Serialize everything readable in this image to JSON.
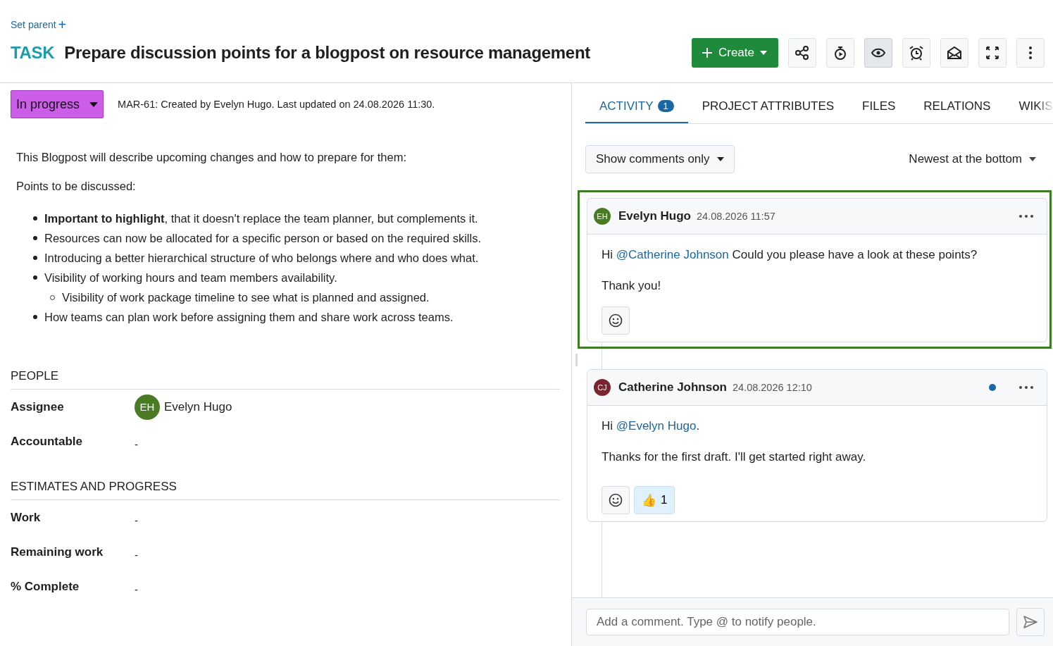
{
  "set_parent": {
    "label": "Set parent",
    "icon": "+"
  },
  "title": {
    "type": "TASK",
    "text": "Prepare discussion points for a blogpost on resource management"
  },
  "toolbar": {
    "create": {
      "label": "Create"
    },
    "buttons": [
      {
        "kind": "share",
        "selected": false
      },
      {
        "kind": "timer",
        "selected": false
      },
      {
        "kind": "watch",
        "selected": true
      },
      {
        "kind": "reminder",
        "selected": false
      },
      {
        "kind": "mail",
        "selected": false
      },
      {
        "kind": "fullscreen",
        "selected": false
      },
      {
        "kind": "more",
        "selected": false
      }
    ]
  },
  "status": {
    "label": "In progress",
    "color": "#cc5de8"
  },
  "meta": "MAR-61: Created by Evelyn Hugo. Last updated on 24.08.2026 11:30.",
  "description": {
    "paragraphs": [
      "This Blogpost will describe upcoming changes and how to prepare for them:",
      "Points to be discussed:"
    ],
    "bullets": [
      {
        "text": "**Important to highlight**, that it doesn't replace the team planner, but complements it."
      },
      {
        "text": "Resources can now be allocated for a specific person or based on the required skills."
      },
      {
        "text": "Introducing a better hierarchical structure of who belongs where and who does what."
      },
      {
        "text": "Visibility of working hours and team members availability.",
        "children": [
          {
            "text": "Visibility of work package timeline to see what is planned and assigned."
          }
        ]
      },
      {
        "text": "How teams can plan work before assigning them and share work across teams."
      }
    ]
  },
  "sections": [
    {
      "title": "PEOPLE",
      "fields": [
        {
          "label": "Assignee",
          "value": "Evelyn Hugo",
          "avatar": {
            "initials": "EH",
            "color": "#4a7a24"
          }
        },
        {
          "label": "Accountable",
          "value": "-"
        }
      ]
    },
    {
      "title": "ESTIMATES AND PROGRESS",
      "fields": [
        {
          "label": "Work",
          "value": "-"
        },
        {
          "label": "Remaining work",
          "value": "-"
        },
        {
          "label": "% Complete",
          "value": "-"
        }
      ]
    }
  ],
  "tabs": [
    {
      "label": "ACTIVITY",
      "badge": "1",
      "selected": true
    },
    {
      "label": "PROJECT ATTRIBUTES",
      "selected": false
    },
    {
      "label": "FILES",
      "selected": false
    },
    {
      "label": "RELATIONS",
      "selected": false
    },
    {
      "label": "WIKIS",
      "selected": false
    }
  ],
  "filter": {
    "label": "Show comments only"
  },
  "sort": {
    "label": "Newest at the bottom"
  },
  "comments": [
    {
      "author": "Evelyn Hugo",
      "initials": "EH",
      "color": "#4a7a24",
      "time": "24.08.2026 11:57",
      "highlighted": true,
      "unread": false,
      "lines": [
        {
          "before": "Hi ",
          "mention": "@Catherine Johnson",
          "after": " Could you please have a look at these points?"
        },
        {
          "before": "Thank you!"
        }
      ]
    },
    {
      "author": "Catherine Johnson",
      "initials": "CJ",
      "color": "#7a2430",
      "time": "24.08.2026 12:10",
      "highlighted": false,
      "unread": true,
      "lines": [
        {
          "before": "Hi ",
          "mention": "@Evelyn Hugo",
          "after": "."
        },
        {
          "before": "Thanks for the first draft. I'll get started right away."
        }
      ],
      "reactions": [
        {
          "emoji": "👍",
          "count": "1"
        }
      ]
    }
  ],
  "comment_input": {
    "placeholder": "Add a comment. Type @ to notify people."
  }
}
